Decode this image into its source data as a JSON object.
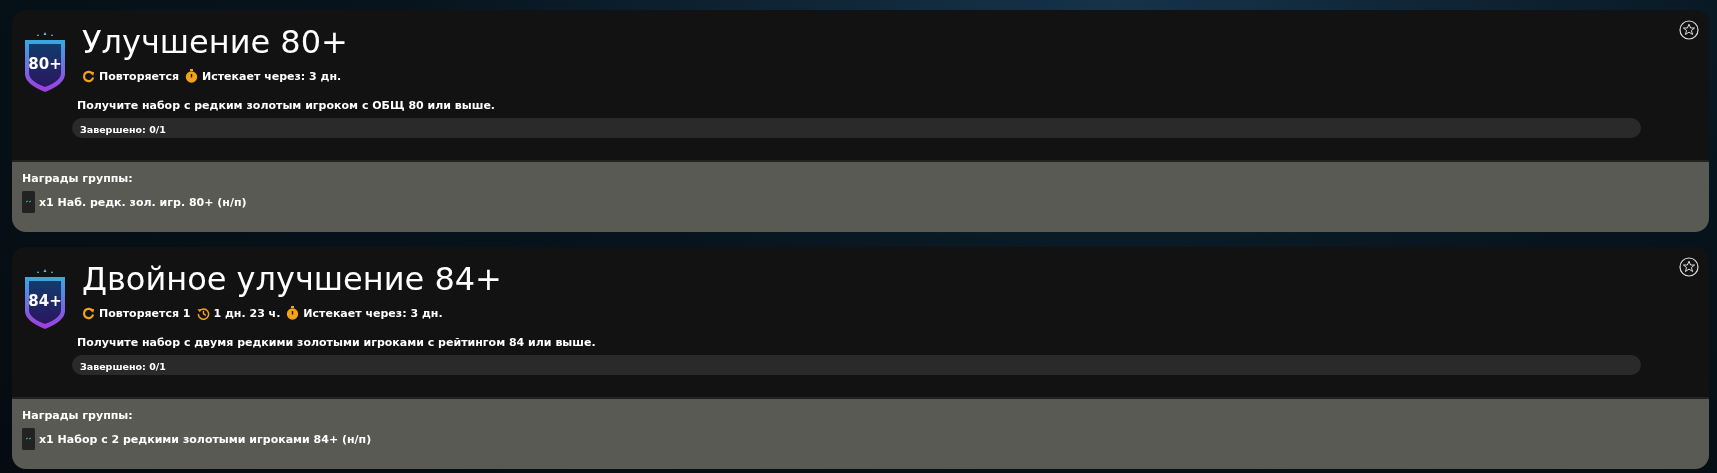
{
  "objectives": [
    {
      "badge": "80+",
      "title": "Улучшение 80+",
      "favorite": false,
      "meta": [
        {
          "kind": "repeat",
          "text": "Повторяется"
        },
        {
          "kind": "expires",
          "text": "Истекает через: 3 дн."
        }
      ],
      "description": "Получите набор с редким золотым игроком с ОБЩ 80 или выше.",
      "progress": {
        "label": "Завершено: 0/1",
        "level": 0
      },
      "rewards_title": "Награды группы:",
      "rewards": [
        {
          "text": "x1 Наб. редк. зол. игр. 80+ (н/п)"
        }
      ]
    },
    {
      "badge": "84+",
      "title": "Двойное улучшение 84+",
      "favorite": false,
      "meta": [
        {
          "kind": "repeat",
          "text": "Повторяется 1"
        },
        {
          "kind": "cooldown",
          "text": "1 дн. 23 ч."
        },
        {
          "kind": "expires",
          "text": "Истекает через: 3 дн."
        }
      ],
      "description": "Получите набор с двумя редкими золотыми игроками с рейтингом 84 или выше.",
      "progress": {
        "label": "Завершено: 0/1",
        "level": 0
      },
      "rewards_title": "Награды группы:",
      "rewards": [
        {
          "text": "x1 Набор с 2 редкими золотыми игроками 84+ (н/п)"
        }
      ]
    }
  ]
}
